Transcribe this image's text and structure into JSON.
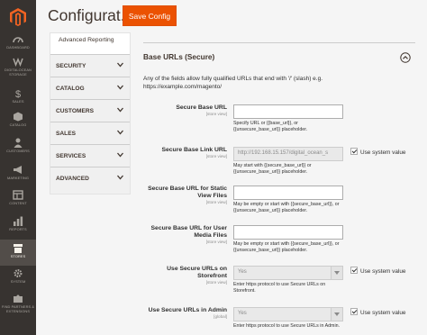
{
  "header": {
    "title": "Configurat...",
    "save_button": "Save Config"
  },
  "nav": {
    "items": [
      {
        "label": "DASHBOARD",
        "icon": "dashboard-icon"
      },
      {
        "label": "DIGITALOCEAN STORAGE",
        "icon": "digitalocean-icon"
      },
      {
        "label": "SALES",
        "icon": "dollar-icon"
      },
      {
        "label": "CATALOG",
        "icon": "cube-icon"
      },
      {
        "label": "CUSTOMERS",
        "icon": "person-icon"
      },
      {
        "label": "MARKETING",
        "icon": "megaphone-icon"
      },
      {
        "label": "CONTENT",
        "icon": "layout-icon"
      },
      {
        "label": "REPORTS",
        "icon": "bar-chart-icon"
      },
      {
        "label": "STORES",
        "icon": "store-icon"
      },
      {
        "label": "SYSTEM",
        "icon": "gear-icon"
      },
      {
        "label": "FIND PARTNERS & EXTENSIONS",
        "icon": "puzzle-icon"
      }
    ],
    "active": "STORES"
  },
  "tabs": {
    "sub_item": "Advanced Reporting",
    "items": [
      {
        "label": "SECURITY"
      },
      {
        "label": "CATALOG"
      },
      {
        "label": "CUSTOMERS"
      },
      {
        "label": "SALES"
      },
      {
        "label": "SERVICES"
      },
      {
        "label": "ADVANCED"
      }
    ]
  },
  "section": {
    "title": "Base URLs (Secure)",
    "description": "Any of the fields allow fully qualified URLs that end with '/' (slash) e.g. https://example.com/magento/"
  },
  "fields": [
    {
      "label": "Secure Base URL",
      "scope": "[store view]",
      "value": "",
      "note": "Specify URL or {{base_url}}, or {{unsecure_base_url}} placeholder."
    },
    {
      "label": "Secure Base Link URL",
      "scope": "[store view]",
      "value": "http://192.168.15.157/digital_ocean_s",
      "note": "May start with {{secure_base_url}} or {{unsecure_base_url}} placeholder.",
      "use_system": "Use system value",
      "use_system_checked": true
    },
    {
      "label": "Secure Base URL for Static View Files",
      "scope": "[store view]",
      "value": "",
      "note": "May be empty or start with {{secure_base_url}}, or {{unsecure_base_url}} placeholder."
    },
    {
      "label": "Secure Base URL for User Media Files",
      "scope": "[store view]",
      "value": "",
      "note": "May be empty or start with {{secure_base_url}}, or {{unsecure_base_url}} placeholder."
    },
    {
      "label": "Use Secure URLs on Storefront",
      "scope": "[store view]",
      "value": "Yes",
      "note": "Enter https protocol to use Secure URLs on Storefront.",
      "use_system": "Use system value",
      "use_system_checked": true
    },
    {
      "label": "Use Secure URLs in Admin",
      "scope": "[global]",
      "value": "Yes",
      "note": "Enter https protocol to use Secure URLs in Admin.",
      "use_system": "Use system value",
      "use_system_checked": true
    }
  ]
}
